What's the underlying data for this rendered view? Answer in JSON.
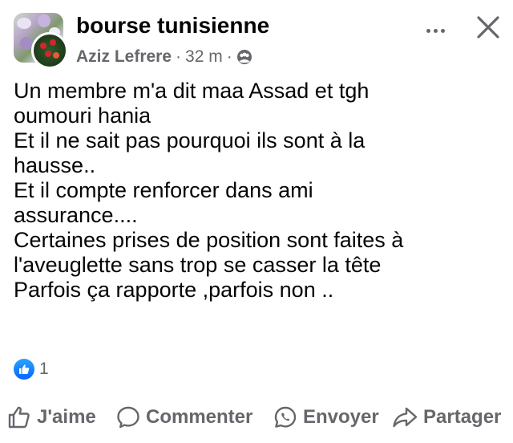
{
  "header": {
    "group_name": "bourse tunisienne",
    "author": "Aziz Lefrere",
    "separator": "·",
    "timestamp": "32 m",
    "audience_icon": "group-audience-icon",
    "more_icon": "more-options-icon",
    "close_icon": "close-icon"
  },
  "post": {
    "lines": [
      "Un membre m'a dit maa Assad et tgh",
      "oumouri hania",
      "Et il ne sait pas pourquoi ils sont à la",
      "hausse..",
      "Et il compte renforcer dans ami",
      "assurance....",
      "Certaines prises de position sont faites à",
      "l'aveuglette sans trop se casser la tête",
      "Parfois ça rapporte ,parfois non .."
    ]
  },
  "reactions": {
    "icon": "like-reaction-icon",
    "count": "1"
  },
  "actions": {
    "like": "J'aime",
    "comment": "Commenter",
    "send": "Envoyer",
    "share": "Partager"
  },
  "colors": {
    "text": "#050505",
    "secondary": "#65676b",
    "like_blue": "#0866ff"
  }
}
